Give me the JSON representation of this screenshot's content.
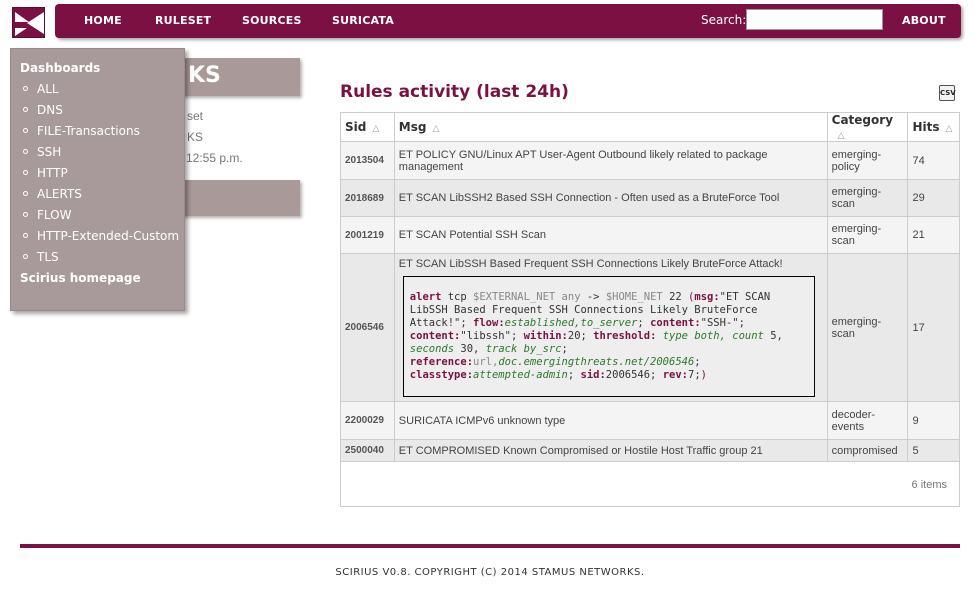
{
  "nav": {
    "home": "HOME",
    "ruleset": "RULESET",
    "sources": "SOURCES",
    "suricata": "SURICATA",
    "search_label": "Search:",
    "search_value": "",
    "about": "ABOUT"
  },
  "background": {
    "title_fragment": "KS",
    "line1": "set",
    "line2": "KS",
    "line3": "12:55 p.m."
  },
  "dropdown": {
    "header": "Dashboards",
    "items": [
      "ALL",
      "DNS",
      "FILE-Transactions",
      "SSH",
      "HTTP",
      "ALERTS",
      "FLOW",
      "HTTP-Extended-Custom",
      "TLS"
    ],
    "footer": "Scirius homepage"
  },
  "main": {
    "title": "Rules activity (last 24h)",
    "export_icon": "csv-export-icon"
  },
  "table": {
    "headers": [
      "Sid",
      "Msg",
      "Category",
      "Hits"
    ],
    "rows": [
      {
        "sid": "2013504",
        "msg": "ET POLICY GNU/Linux APT User-Agent Outbound likely related to package management",
        "category": "emerging-policy",
        "hits": "74"
      },
      {
        "sid": "2018689",
        "msg": "ET SCAN LibSSH2 Based SSH Connection - Often used as a BruteForce Tool",
        "category": "emerging-scan",
        "hits": "29"
      },
      {
        "sid": "2001219",
        "msg": "ET SCAN Potential SSH Scan",
        "category": "emerging-scan",
        "hits": "21"
      },
      {
        "sid": "2006546",
        "msg": "ET SCAN LibSSH Based Frequent SSH Connections Likely BruteForce Attack!",
        "category": "emerging-scan",
        "hits": "17"
      },
      {
        "sid": "2200029",
        "msg": "SURICATA ICMPv6 unknown type",
        "category": "decoder-events",
        "hits": "9"
      },
      {
        "sid": "2500040",
        "msg": "ET COMPROMISED Known Compromised or Hostile Host Traffic group 21",
        "category": "compromised",
        "hits": "5"
      }
    ],
    "count": "6 items"
  },
  "rule": {
    "alert": "alert",
    "tcp": "tcp",
    "ext_net": "$EXTERNAL_NET",
    "any": "any",
    "arrow": "->",
    "home_net": "$HOME_NET",
    "port": "22",
    "msg_kw": "msg:",
    "msg_val": "\"ET SCAN LibSSH Based Frequent SSH Connections Likely BruteForce Attack!\";",
    "flow_kw": "flow:",
    "flow_val": "established,to_server",
    "content_kw": "content:",
    "content_val1": "\"SSH-\";",
    "content_val2": "\"libssh\";",
    "within_kw": "within:",
    "within_val": "20;",
    "threshold_kw": "threshold:",
    "threshold_val": "type both, count",
    "count_val": "5,",
    "seconds_val": "seconds",
    "seconds_num": "30,",
    "track_val": "track by_src",
    "reference_kw": "reference:",
    "ref_url": "url,",
    "ref_val": "doc.emergingthreats.net/2006546",
    "classtype_kw": "classtype:",
    "classtype_val": "attempted-admin",
    "sid_kw": "sid:",
    "sid_val": "2006546;",
    "rev_kw": "rev:",
    "rev_val": "7;"
  },
  "footer": {
    "copyright": "SCIRIUS V0.8. COPYRIGHT (C) 2014 STAMUS NETWORKS."
  },
  "colors": {
    "brand": "#7b1143",
    "menu_bg": "#a89a9a"
  }
}
